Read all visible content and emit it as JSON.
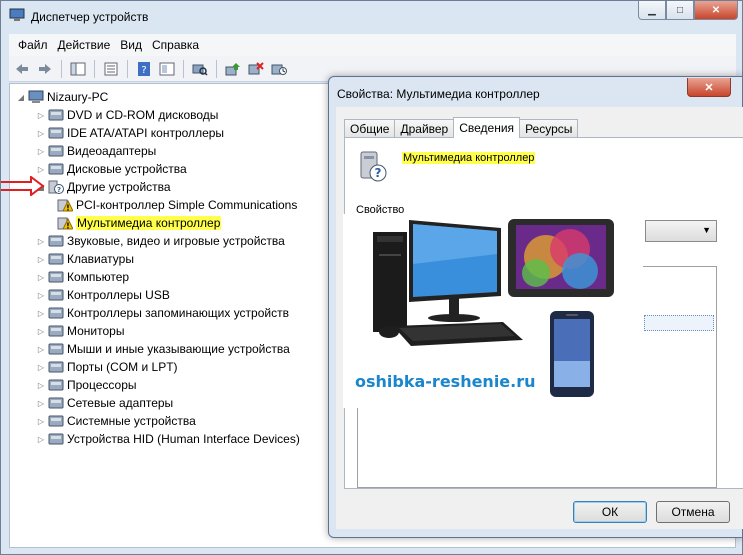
{
  "window": {
    "title": "Диспетчер устройств",
    "min_glyph": "▁",
    "max_glyph": "□",
    "close_glyph": "✕"
  },
  "menu": [
    "Файл",
    "Действие",
    "Вид",
    "Справка"
  ],
  "toolbar": [
    "back-icon",
    "forward-icon",
    "console-tree-icon",
    "properties-icon",
    "help-icon",
    "show-hidden-icon",
    "scan-hardware-icon",
    "update-driver-icon",
    "disable-device-icon",
    "uninstall-device-icon"
  ],
  "tree": {
    "root": "Nizaury-PC",
    "items": [
      {
        "label": "DVD и CD-ROM дисководы",
        "icon": "dvd-drive-icon"
      },
      {
        "label": "IDE ATA/ATAPI контроллеры",
        "icon": "ide-controller-icon"
      },
      {
        "label": "Видеоадаптеры",
        "icon": "display-adapter-icon"
      },
      {
        "label": "Дисковые устройства",
        "icon": "disk-drive-icon"
      },
      {
        "label": "Другие устройства",
        "icon": "unknown-device-icon"
      },
      {
        "label": "PCI-контроллер Simple Communications",
        "icon": "warning-device-icon"
      },
      {
        "label": "Мультимедиа контроллер",
        "icon": "warning-device-icon"
      },
      {
        "label": "Звуковые, видео и игровые устройства",
        "icon": "sound-icon"
      },
      {
        "label": "Клавиатуры",
        "icon": "keyboard-icon"
      },
      {
        "label": "Компьютер",
        "icon": "computer-icon"
      },
      {
        "label": "Контроллеры USB",
        "icon": "usb-icon"
      },
      {
        "label": "Контроллеры запоминающих устройств",
        "icon": "storage-controller-icon"
      },
      {
        "label": "Мониторы",
        "icon": "monitor-icon"
      },
      {
        "label": "Мыши и иные указывающие устройства",
        "icon": "mouse-icon"
      },
      {
        "label": "Порты (COM и LPT)",
        "icon": "port-icon"
      },
      {
        "label": "Процессоры",
        "icon": "processor-icon"
      },
      {
        "label": "Сетевые адаптеры",
        "icon": "network-adapter-icon"
      },
      {
        "label": "Системные устройства",
        "icon": "system-device-icon"
      },
      {
        "label": "Устройства HID (Human Interface Devices)",
        "icon": "hid-icon"
      }
    ]
  },
  "dialog": {
    "title": "Свойства: Мультимедиа контроллер",
    "close_glyph": "✕",
    "tabs": [
      "Общие",
      "Драйвер",
      "Сведения",
      "Ресурсы"
    ],
    "device_name": "Мультимедиа контроллер",
    "property_label": "Свойство",
    "ok": "ОК",
    "cancel": "Отмена"
  },
  "watermark": "oshibka-reshenie.ru",
  "colors": {
    "highlight": "#ffff4c",
    "arrow": "#e02020",
    "watermark": "#1a86cc"
  }
}
